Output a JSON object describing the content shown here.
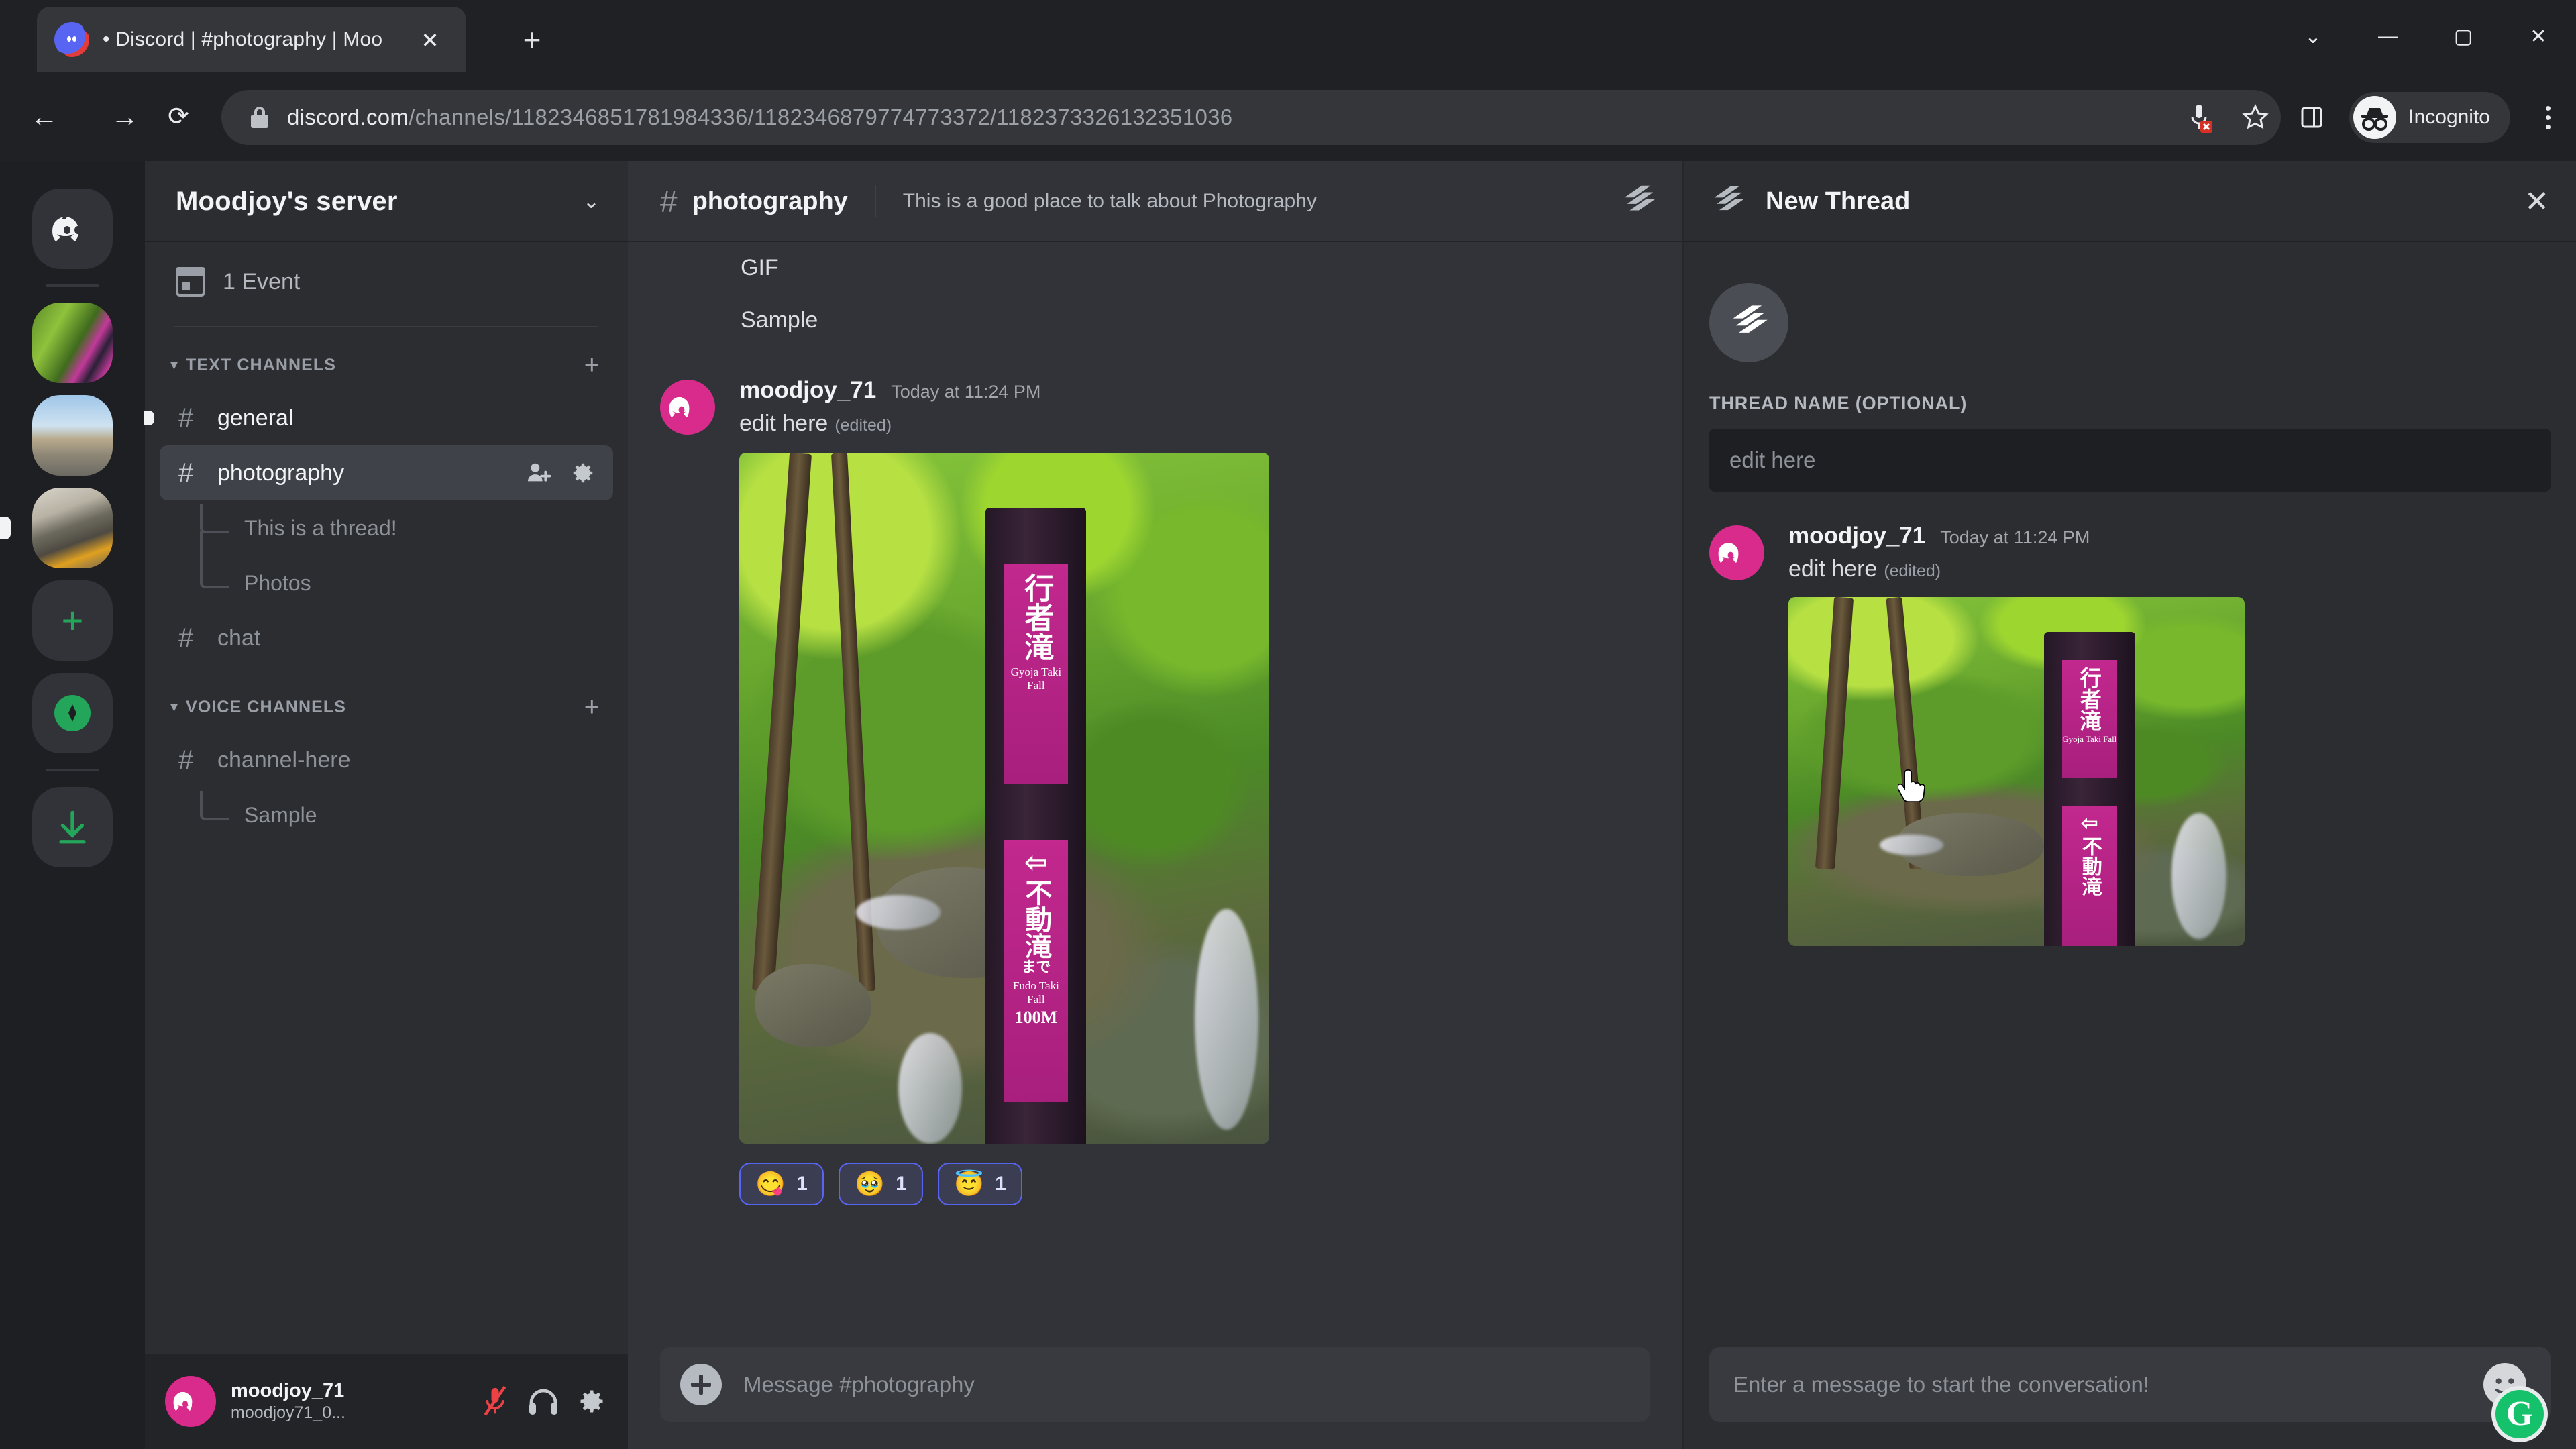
{
  "browser": {
    "tab": {
      "title": "• Discord | #photography | Moo",
      "close_label": "✕",
      "favicon": "discord-icon"
    },
    "new_tab_label": "+",
    "window_controls": {
      "minimize": "⌄",
      "restore": "—",
      "maximize": "▢",
      "close": "✕"
    },
    "nav": {
      "back": "←",
      "forward": "→",
      "reload": "⟳"
    },
    "url": {
      "domain": "discord.com",
      "path": "/channels/1182346851781984336/1182346879774773372/1182373326132351036",
      "lock": "lock-icon"
    },
    "toolbar_right": {
      "mic_blocked": "mic-blocked-icon",
      "bookmark": "star-icon",
      "side_panel": "side-panel-icon",
      "profile_label": "Incognito",
      "menu": "three-dot-menu-icon"
    }
  },
  "rail": {
    "home_label": "discord-home-icon",
    "servers": [
      {
        "name": "server-thumb-1"
      },
      {
        "name": "server-thumb-2"
      },
      {
        "name": "server-thumb-3"
      }
    ],
    "add_server_label": "+",
    "explore_label": "compass-icon",
    "download_label": "download-icon"
  },
  "sidebar": {
    "server_name": "Moodjoy's server",
    "chevron": "⌄",
    "events_label": "1 Event",
    "categories": [
      {
        "title": "TEXT CHANNELS",
        "add_label": "+",
        "channels": [
          {
            "name": "general",
            "hash": "#",
            "state": "unread",
            "threads": []
          },
          {
            "name": "photography",
            "hash": "#",
            "state": "active",
            "threads": [
              {
                "name": "This is a thread!"
              },
              {
                "name": "Photos"
              }
            ]
          },
          {
            "name": "chat",
            "hash": "#",
            "state": "idle",
            "threads": []
          }
        ]
      },
      {
        "title": "VOICE CHANNELS",
        "add_label": "+",
        "channels": [
          {
            "name": "channel-here",
            "hash": "#",
            "state": "idle",
            "threads": [
              {
                "name": "Sample"
              }
            ]
          }
        ]
      }
    ],
    "user": {
      "name": "moodjoy_71",
      "tag": "moodjoy71_0...",
      "mic_icon": "mic-muted-icon",
      "headset_icon": "headset-icon",
      "settings_icon": "gear-icon"
    }
  },
  "channel": {
    "hash": "#",
    "name": "photography",
    "topic": "This is a good place to talk about Photography",
    "threads_icon": "threads-icon",
    "previous_messages": [
      "GIF",
      "Sample"
    ],
    "message": {
      "author": "moodjoy_71",
      "timestamp": "Today at 11:24 PM",
      "text": "edit here",
      "edited_label": "(edited)",
      "attachment": {
        "alt": "forest waterfall trail sign",
        "sign_top_jp": "行者滝",
        "sign_top_romaji": "Gyoja Taki Fall",
        "sign_bottom_arrow": "⇦",
        "sign_bottom_jp": "不動滝",
        "sign_bottom_jp2": "まで",
        "sign_bottom_romaji": "Fudo Taki Fall",
        "sign_bottom_distance": "100M"
      },
      "reactions": [
        {
          "emoji": "😋",
          "count": "1"
        },
        {
          "emoji": "🥹",
          "count": "1"
        },
        {
          "emoji": "😇",
          "count": "1"
        }
      ]
    },
    "composer_placeholder": "Message #photography",
    "add_attachment_label": "+"
  },
  "thread_panel": {
    "icon": "threads-icon",
    "title": "New Thread",
    "close_label": "✕",
    "big_icon": "threads-icon",
    "name_field_label": "THREAD NAME (OPTIONAL)",
    "name_field_value": "edit here",
    "message": {
      "author": "moodjoy_71",
      "timestamp": "Today at 11:24 PM",
      "text": "edit here",
      "edited_label": "(edited)",
      "attachment": {
        "alt": "forest waterfall trail sign",
        "sign_top_jp": "行者滝",
        "sign_top_romaji": "Gyoja Taki Fall",
        "sign_bottom_arrow": "⇦",
        "sign_bottom_jp": "不動滝"
      }
    },
    "composer_placeholder": "Enter a message to start the conversation!",
    "emoji_button": "emoji-icon",
    "grammarly_badge": "G"
  },
  "colors": {
    "discord_blurple": "#5865f2",
    "avatar_pink": "#d92b8b",
    "accent_green": "#23a55a",
    "grammarly_green": "#15c26b",
    "bg_chat": "#313338",
    "bg_sidebar": "#2b2d31",
    "bg_rail": "#1e1f22",
    "browser_bg": "#202124"
  }
}
